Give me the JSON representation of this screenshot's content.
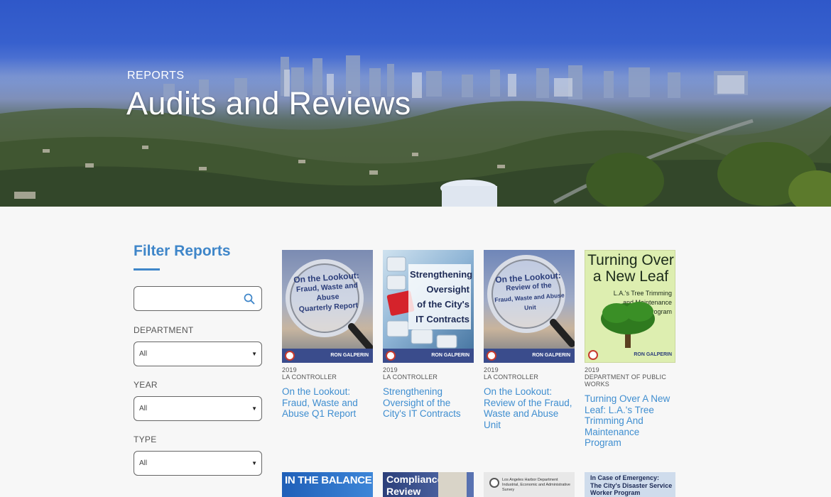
{
  "hero": {
    "eyebrow": "REPORTS",
    "title": "Audits and Reviews"
  },
  "sidebar": {
    "title": "Filter Reports",
    "search": {
      "placeholder": "",
      "value": ""
    },
    "filters": [
      {
        "label": "DEPARTMENT",
        "value": "All"
      },
      {
        "label": "YEAR",
        "value": "All"
      },
      {
        "label": "TYPE",
        "value": "All"
      }
    ]
  },
  "reports": [
    {
      "year": "2019",
      "department": "LA CONTROLLER",
      "title": "On the Lookout: Fraud, Waste and Abuse Q1 Report",
      "cover_text": [
        "On the Lookout:",
        "Fraud, Waste and Abuse",
        "Quarterly Report"
      ],
      "cover_brand": "RON GALPERIN"
    },
    {
      "year": "2019",
      "department": "LA CONTROLLER",
      "title": "Strengthening Oversight of the City's IT Contracts",
      "cover_text": [
        "Strengthening",
        "Oversight",
        "of the City's",
        "IT Contracts"
      ],
      "cover_brand": "RON GALPERIN"
    },
    {
      "year": "2019",
      "department": "LA CONTROLLER",
      "title": "On the Lookout: Review of the Fraud, Waste and Abuse Unit",
      "cover_text": [
        "On the Lookout:",
        "Review of the",
        "Fraud, Waste and Abuse Unit"
      ],
      "cover_brand": "RON GALPERIN"
    },
    {
      "year": "2019",
      "department": "DEPARTMENT OF PUBLIC WORKS",
      "title": "Turning Over A New Leaf: L.A.'s Tree Trimming And Maintenance Program",
      "cover_text": [
        "Turning Over",
        "a New Leaf",
        "L.A.'s Tree Trimming",
        "and Maintenance",
        "Program"
      ],
      "cover_brand": "RON GALPERIN"
    }
  ],
  "more_reports": [
    {
      "cover_text": [
        "IN THE BALANCE"
      ]
    },
    {
      "cover_text": [
        "Compliance",
        "Review"
      ]
    },
    {
      "cover_text": [
        "Los Angeles Harbor Department",
        "Industrial, Economic and Administrative Survey"
      ]
    },
    {
      "cover_text": [
        "In Case of Emergency:",
        "The City's Disaster Service",
        "Worker Program"
      ]
    }
  ],
  "colors": {
    "accent": "#3f86c9",
    "cover_blue": "#3a4c8c"
  }
}
